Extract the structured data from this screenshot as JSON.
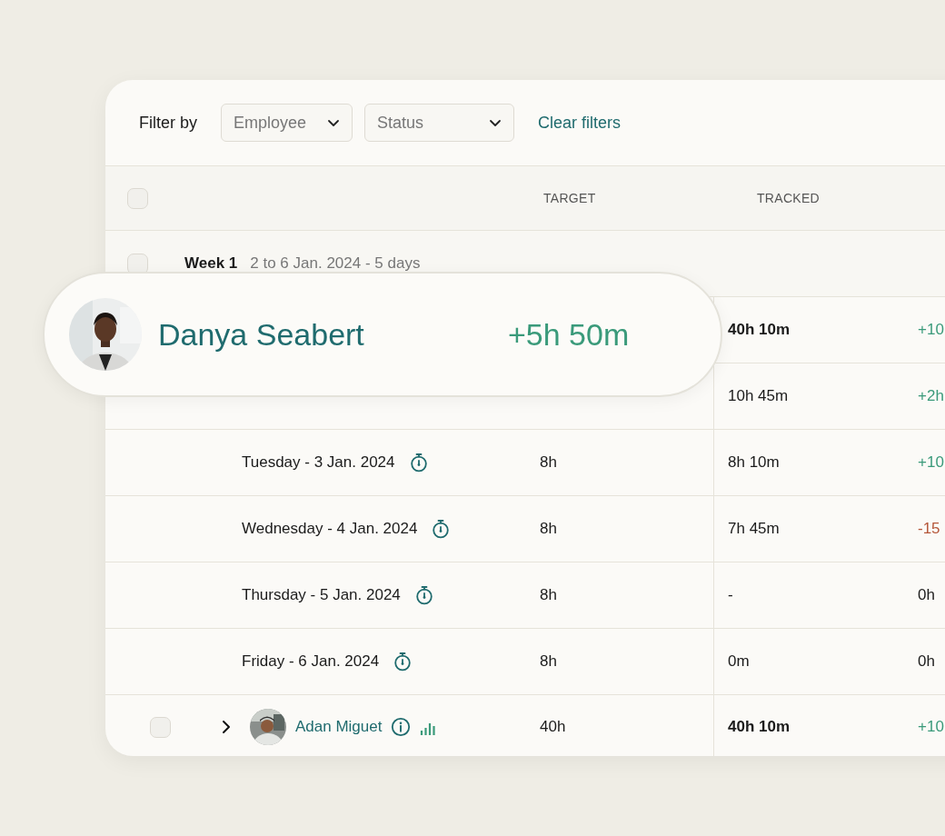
{
  "filter_bar": {
    "label": "Filter by",
    "dropdowns": [
      {
        "label": "Employee"
      },
      {
        "label": "Status"
      }
    ],
    "clear_link": "Clear filters"
  },
  "table": {
    "header": {
      "checked": false,
      "columns": [
        "TARGET",
        "TRACKED"
      ]
    },
    "rows": [
      {
        "kind": "week",
        "checked": false,
        "title": "Week 1",
        "subtitle": "2 to 6 Jan. 2024 - 5 days"
      },
      {
        "kind": "total",
        "tracked": "40h 10m",
        "balance": "+10",
        "color": "#3a9a7a"
      },
      {
        "kind": "covered",
        "tracked": "10h 45m",
        "balance": "+2h",
        "color": "#3a9a7a"
      },
      {
        "kind": "day",
        "date": "Tuesday - 3 Jan. 2024",
        "target": "8h",
        "tracked": "8h 10m",
        "balance": "+10",
        "color": "#3a9a7a"
      },
      {
        "kind": "day",
        "date": "Wednesday - 4 Jan. 2024",
        "target": "8h",
        "tracked": "7h 45m",
        "balance": "-15",
        "color": "#b5573a"
      },
      {
        "kind": "day",
        "date": "Thursday - 5 Jan. 2024",
        "target": "8h",
        "tracked": "-",
        "balance": "0h",
        "color": "#1b1b1b"
      },
      {
        "kind": "day",
        "date": "Friday - 6 Jan. 2024",
        "target": "8h",
        "tracked": "0m",
        "balance": "0h",
        "color": "#1b1b1b"
      },
      {
        "kind": "employee",
        "checked": false,
        "expanded": false,
        "name": "Adan Miguet",
        "target": "40h",
        "tracked": "40h 10m",
        "balance": "+10",
        "color": "#3a9a7a"
      }
    ]
  },
  "highlight": {
    "name": "Danya Seabert",
    "balance": "+5h 50m"
  }
}
